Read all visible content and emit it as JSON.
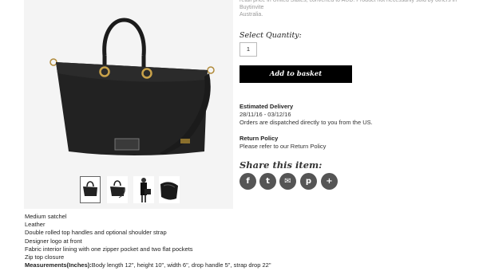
{
  "notice": {
    "line1": "retail price in United States, converted to AUD. Product not necessarily sold by others in Buytinvite",
    "line2": "Australia."
  },
  "quantity": {
    "label": "Select Quantity:",
    "value": "1"
  },
  "basket": {
    "label": "Add to basket"
  },
  "delivery": {
    "heading": "Estimated Delivery",
    "dates": "28/11/16 - 03/12/16",
    "note": "Orders are dispatched directly to you from the US."
  },
  "returns": {
    "heading": "Return Policy",
    "note": "Please refer to our Return Policy"
  },
  "share": {
    "title": "Share this item:",
    "icons": [
      {
        "name": "facebook-icon",
        "glyph": "f"
      },
      {
        "name": "twitter-icon",
        "glyph": "t"
      },
      {
        "name": "email-icon",
        "glyph": "✉"
      },
      {
        "name": "pinterest-icon",
        "glyph": "p"
      },
      {
        "name": "more-icon",
        "glyph": "+"
      }
    ]
  },
  "gallery": {
    "main_image": "black-leather-satchel-bag",
    "thumbnails": [
      "bag-front-view",
      "bag-with-strap-view",
      "model-carrying-bag-view",
      "bag-interior-view"
    ],
    "active_thumbnail": 0
  },
  "details": {
    "lines": [
      "Medium satchel",
      "Leather",
      "Double rolled top handles and optional shoulder strap",
      "Designer logo at front",
      "Fabric interior lining with one zipper pocket and two flat pockets",
      "Zip top closure"
    ],
    "measurements_label": "Measurements(Inches):",
    "measurements_value": "Body length 12\", height 10\", width 6\", drop handle 5\", strap drop 22\""
  },
  "colors": {
    "button_bg": "#000000",
    "icon_bg": "#555555",
    "gallery_bg": "#f4f4f4"
  }
}
